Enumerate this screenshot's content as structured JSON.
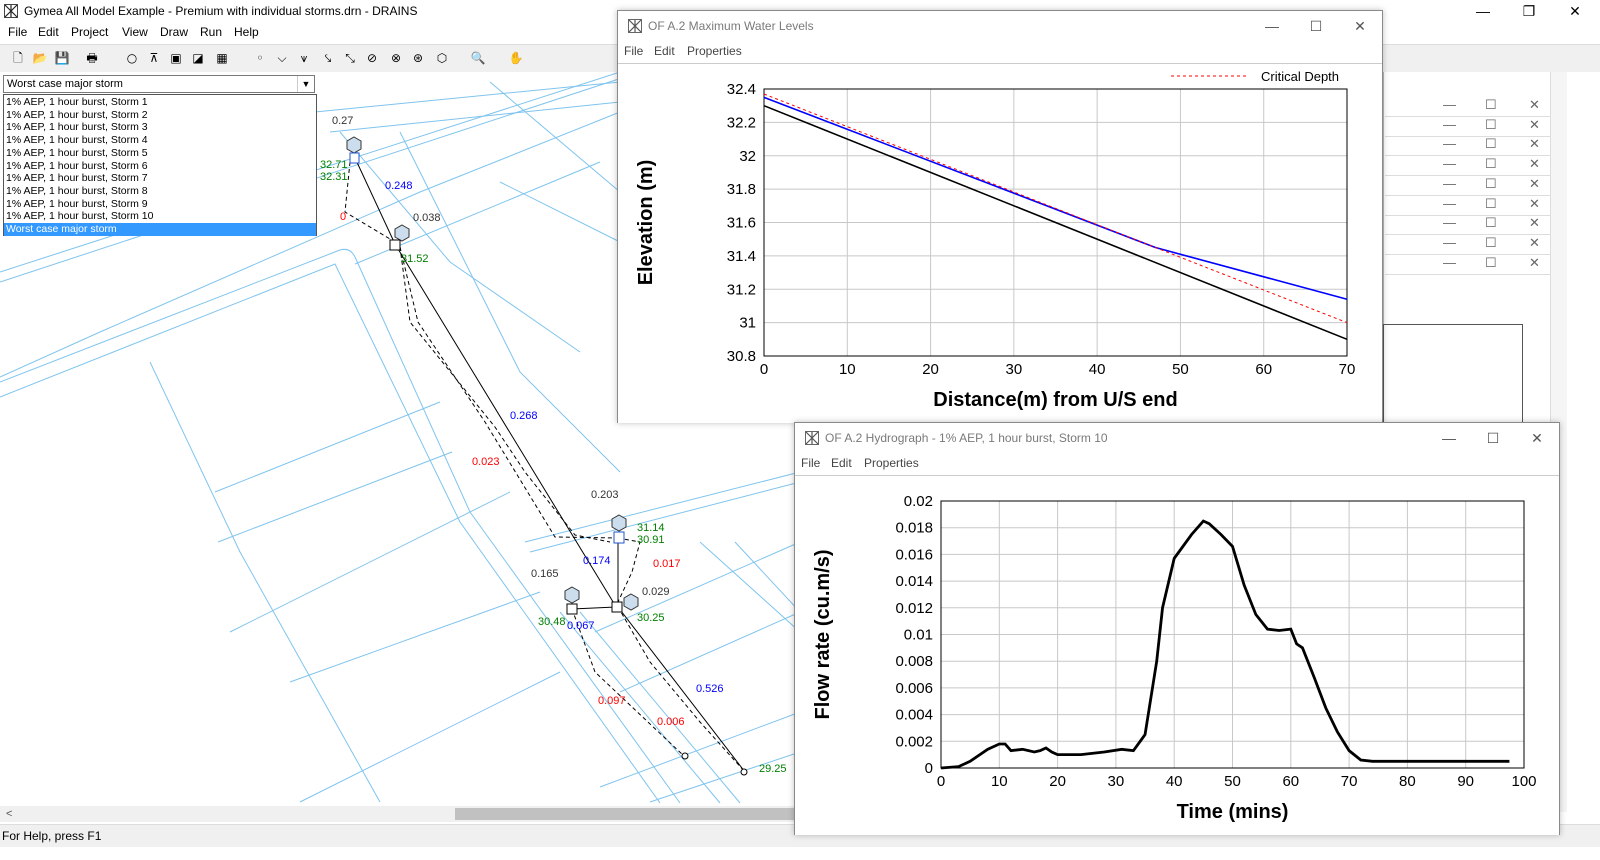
{
  "app": {
    "title": "Gymea All Model Example - Premium with individual storms.drn - DRAINS",
    "minimize": "—",
    "maximize": "❐",
    "close": "✕"
  },
  "menu": [
    "File",
    "Edit",
    "Project",
    "View",
    "Draw",
    "Run",
    "Help"
  ],
  "toolbar": {
    "icons": [
      "new-file-icon",
      "open-folder-icon",
      "save-icon",
      "print-icon",
      "node-icon",
      "pit-icon",
      "detention-basin-icon",
      "overflow-route-icon",
      "grid-icon",
      "pit-tool-icon",
      "channel-icon",
      "junction-icon",
      "pipe-icon",
      "overflow-line-icon",
      "link-icon",
      "diversion-icon",
      "weir-icon",
      "sub-catchment-icon",
      "zoom-icon",
      "pan-hand-icon"
    ],
    "glyphs": [
      "🗋",
      "📂",
      "💾",
      "🖶",
      "○",
      "⊼",
      "▣",
      "◪",
      "▦",
      "◦",
      "⌵",
      "⩛",
      "⤥",
      "⤡",
      "⊘",
      "⊗",
      "⊛",
      "⬡",
      "🔍",
      "✋"
    ]
  },
  "storm_selector": {
    "selected": "Worst case major storm",
    "options": [
      "1% AEP, 1 hour burst, Storm 1",
      "1% AEP, 1 hour burst, Storm 2",
      "1% AEP, 1 hour burst, Storm 3",
      "1% AEP, 1 hour burst, Storm 4",
      "1% AEP, 1 hour burst, Storm 5",
      "1% AEP, 1 hour burst, Storm 6",
      "1% AEP, 1 hour burst, Storm 7",
      "1% AEP, 1 hour burst, Storm 8",
      "1% AEP, 1 hour burst, Storm 9",
      "1% AEP, 1 hour burst, Storm 10",
      "Worst case major storm"
    ]
  },
  "network_labels": {
    "black": [
      "0.27",
      "0.038",
      "0.203",
      "0.165",
      "0.029"
    ],
    "blue": [
      "0.248",
      "0.268",
      "0.174",
      "0.067",
      "0.526"
    ],
    "red": [
      "0",
      "0.023",
      "0.017",
      "0.097",
      "0.006"
    ],
    "green": [
      "32.71",
      "32.31",
      "31.52",
      "31.14",
      "30.91",
      "30.48",
      "30.25",
      "29.25"
    ]
  },
  "colors": {
    "flow_blue": "#0000ff",
    "red_label": "#ff0000",
    "green_label": "#008000",
    "property_line": "#7fc4ee",
    "highlight": "#3399ff"
  },
  "status": "For Help, press F1",
  "water_levels_window": {
    "title": "OF A.2 Maximum Water Levels",
    "menu": [
      "File",
      "Edit",
      "Properties"
    ]
  },
  "hydrograph_window": {
    "title": "OF A.2 Hydrograph - 1% AEP, 1 hour burst, Storm 10",
    "menu": [
      "File",
      "Edit",
      "Properties"
    ]
  },
  "background_windows": {
    "rows": 9
  },
  "chart_data": [
    {
      "type": "line",
      "title": "",
      "xlabel": "Distance(m) from U/S end",
      "ylabel": "Elevation (m)",
      "xlim": [
        0,
        70
      ],
      "ylim": [
        30.8,
        32.4
      ],
      "xticks": [
        "0",
        "10",
        "20",
        "30",
        "40",
        "50",
        "60",
        "70"
      ],
      "yticks": [
        "32.4",
        "32.2",
        "32",
        "31.8",
        "31.6",
        "31.4",
        "31.2",
        "31",
        "30.8"
      ],
      "legend_position": "top-right",
      "grid": true,
      "series": [
        {
          "name": "",
          "color": "#0000ff",
          "x": [
            0,
            47,
            70
          ],
          "y": [
            32.35,
            31.45,
            31.14
          ]
        },
        {
          "name": "",
          "color": "#000000",
          "x": [
            0,
            70
          ],
          "y": [
            32.3,
            30.9
          ]
        },
        {
          "name": "Critical Depth",
          "color": "#ff0000",
          "dashed": true,
          "x": [
            0,
            47,
            70
          ],
          "y": [
            32.37,
            31.45,
            31.0
          ]
        }
      ]
    },
    {
      "type": "line",
      "title": "",
      "xlabel": "Time (mins)",
      "ylabel": "Flow rate (cu.m/s)",
      "xlim": [
        0,
        100
      ],
      "ylim": [
        0,
        0.02
      ],
      "xticks": [
        "0",
        "10",
        "20",
        "30",
        "40",
        "50",
        "60",
        "70",
        "80",
        "90",
        "100"
      ],
      "yticks": [
        "0.02",
        "0.018",
        "0.016",
        "0.014",
        "0.012",
        "0.01",
        "0.008",
        "0.006",
        "0.004",
        "0.002",
        "0"
      ],
      "grid": true,
      "series": [
        {
          "name": "",
          "color": "#000000",
          "x": [
            0,
            3,
            5,
            8,
            10,
            11,
            12,
            14,
            16,
            17,
            18,
            19,
            20,
            24,
            28,
            31,
            33,
            35,
            37,
            38,
            40,
            43,
            45,
            46,
            48,
            50,
            52,
            54,
            56,
            58,
            60,
            61,
            62,
            64,
            66,
            68,
            70,
            72,
            74,
            80,
            90,
            97.5
          ],
          "y": [
            0,
            0.0001,
            0.0005,
            0.0014,
            0.0018,
            0.0018,
            0.0013,
            0.0014,
            0.0012,
            0.0013,
            0.0015,
            0.0012,
            0.001,
            0.001,
            0.0012,
            0.0014,
            0.0013,
            0.0025,
            0.008,
            0.012,
            0.0157,
            0.0175,
            0.0185,
            0.0183,
            0.0175,
            0.0166,
            0.0137,
            0.0115,
            0.0104,
            0.0103,
            0.0104,
            0.0093,
            0.009,
            0.0068,
            0.0045,
            0.0027,
            0.0013,
            0.0006,
            0.0005,
            0.0005,
            0.0005,
            0.0005
          ]
        }
      ]
    }
  ]
}
